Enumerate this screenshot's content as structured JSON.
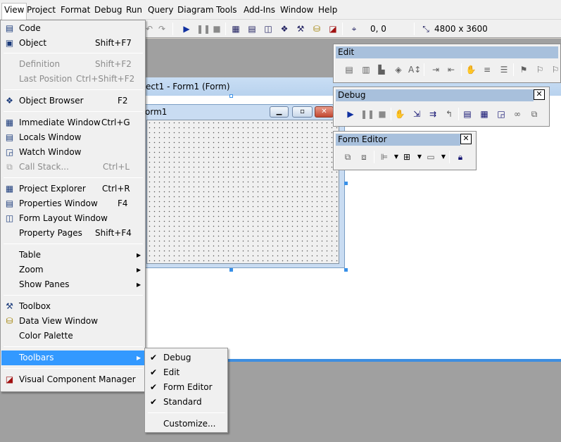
{
  "menubar": {
    "items": [
      "View",
      "Project",
      "Format",
      "Debug",
      "Run",
      "Query",
      "Diagram",
      "Tools",
      "Add-Ins",
      "Window",
      "Help"
    ]
  },
  "std_toolbar": {
    "icons": [
      "undo-icon",
      "redo-icon",
      "run-icon",
      "pause-icon",
      "stop-icon",
      "project-explorer-icon",
      "properties-icon",
      "form-layout-icon",
      "object-browser-icon",
      "toolbox-icon",
      "data-view-icon",
      "component-manager-icon",
      "position-icon",
      "size-icon"
    ],
    "position": "0, 0",
    "size": "4800 x 3600"
  },
  "workspace": {
    "project_title": "ect1 - Form1 (Form)",
    "form_caption": "orm1",
    "caption_buttons": [
      "minimize",
      "maximize",
      "close"
    ]
  },
  "edit_toolbar": {
    "title": "Edit",
    "icons": [
      "list-properties-icon",
      "list-constants-icon",
      "quick-info-icon",
      "parameter-info-icon",
      "complete-word-icon",
      "indent-icon",
      "outdent-icon",
      "toggle-breakpoint-icon",
      "comment-block-icon",
      "uncomment-block-icon",
      "toggle-bookmark-icon",
      "next-bookmark-icon",
      "previous-bookmark-icon"
    ]
  },
  "debug_toolbar": {
    "title": "Debug",
    "close": "✕",
    "icons": [
      "start-icon",
      "break-icon",
      "end-icon",
      "toggle-breakpoint-icon",
      "step-into-icon",
      "step-over-icon",
      "step-out-icon",
      "locals-window-icon",
      "immediate-window-icon",
      "watch-window-icon",
      "quick-watch-icon",
      "call-stack-icon"
    ]
  },
  "form_editor_toolbar": {
    "title": "Form Editor",
    "close": "✕",
    "icons": [
      "bring-to-front-icon",
      "send-to-back-icon",
      "align-icon",
      "center-icon",
      "make-same-size-icon",
      "lock-controls-icon"
    ]
  },
  "view_menu": {
    "items": [
      {
        "label": "Code",
        "shortcut": "",
        "icon": "code-icon",
        "state": "normal"
      },
      {
        "label": "Object",
        "shortcut": "Shift+F7",
        "icon": "object-icon",
        "state": "normal"
      },
      {
        "label": "Definition",
        "shortcut": "Shift+F2",
        "icon": "",
        "state": "disabled"
      },
      {
        "label": "Last Position",
        "shortcut": "Ctrl+Shift+F2",
        "icon": "",
        "state": "disabled"
      },
      {
        "label": "Object Browser",
        "shortcut": "F2",
        "icon": "object-browser-icon",
        "state": "normal"
      },
      {
        "label": "Immediate Window",
        "shortcut": "Ctrl+G",
        "icon": "immediate-window-icon",
        "state": "normal"
      },
      {
        "label": "Locals Window",
        "shortcut": "",
        "icon": "locals-window-icon",
        "state": "normal"
      },
      {
        "label": "Watch Window",
        "shortcut": "",
        "icon": "watch-window-icon",
        "state": "normal"
      },
      {
        "label": "Call Stack...",
        "shortcut": "Ctrl+L",
        "icon": "call-stack-icon",
        "state": "disabled"
      },
      {
        "label": "Project Explorer",
        "shortcut": "Ctrl+R",
        "icon": "project-explorer-icon",
        "state": "normal"
      },
      {
        "label": "Properties Window",
        "shortcut": "F4",
        "icon": "properties-icon",
        "state": "normal"
      },
      {
        "label": "Form Layout Window",
        "shortcut": "",
        "icon": "form-layout-icon",
        "state": "normal"
      },
      {
        "label": "Property Pages",
        "shortcut": "Shift+F4",
        "icon": "",
        "state": "normal"
      },
      {
        "label": "Table",
        "shortcut": "",
        "icon": "",
        "state": "submenu"
      },
      {
        "label": "Zoom",
        "shortcut": "",
        "icon": "",
        "state": "submenu"
      },
      {
        "label": "Show Panes",
        "shortcut": "",
        "icon": "",
        "state": "submenu"
      },
      {
        "label": "Toolbox",
        "shortcut": "",
        "icon": "toolbox-icon",
        "state": "normal"
      },
      {
        "label": "Data View Window",
        "shortcut": "",
        "icon": "data-view-icon",
        "state": "normal"
      },
      {
        "label": "Color Palette",
        "shortcut": "",
        "icon": "",
        "state": "normal"
      },
      {
        "label": "Toolbars",
        "shortcut": "",
        "icon": "",
        "state": "highlighted-submenu"
      },
      {
        "label": "Visual Component Manager",
        "shortcut": "",
        "icon": "component-manager-icon",
        "state": "normal"
      }
    ]
  },
  "toolbars_submenu": {
    "items": [
      {
        "label": "Debug",
        "checked": true
      },
      {
        "label": "Edit",
        "checked": true
      },
      {
        "label": "Form Editor",
        "checked": true
      },
      {
        "label": "Standard",
        "checked": true
      },
      {
        "label": "Customize...",
        "checked": false
      }
    ]
  },
  "colors": {
    "menu_highlight": "#3399ff",
    "menu_background": "#f0f0f0",
    "workspace": "#a0a0a0",
    "title_bar": "#a8c0dc",
    "selection_handle": "#3890e8"
  }
}
